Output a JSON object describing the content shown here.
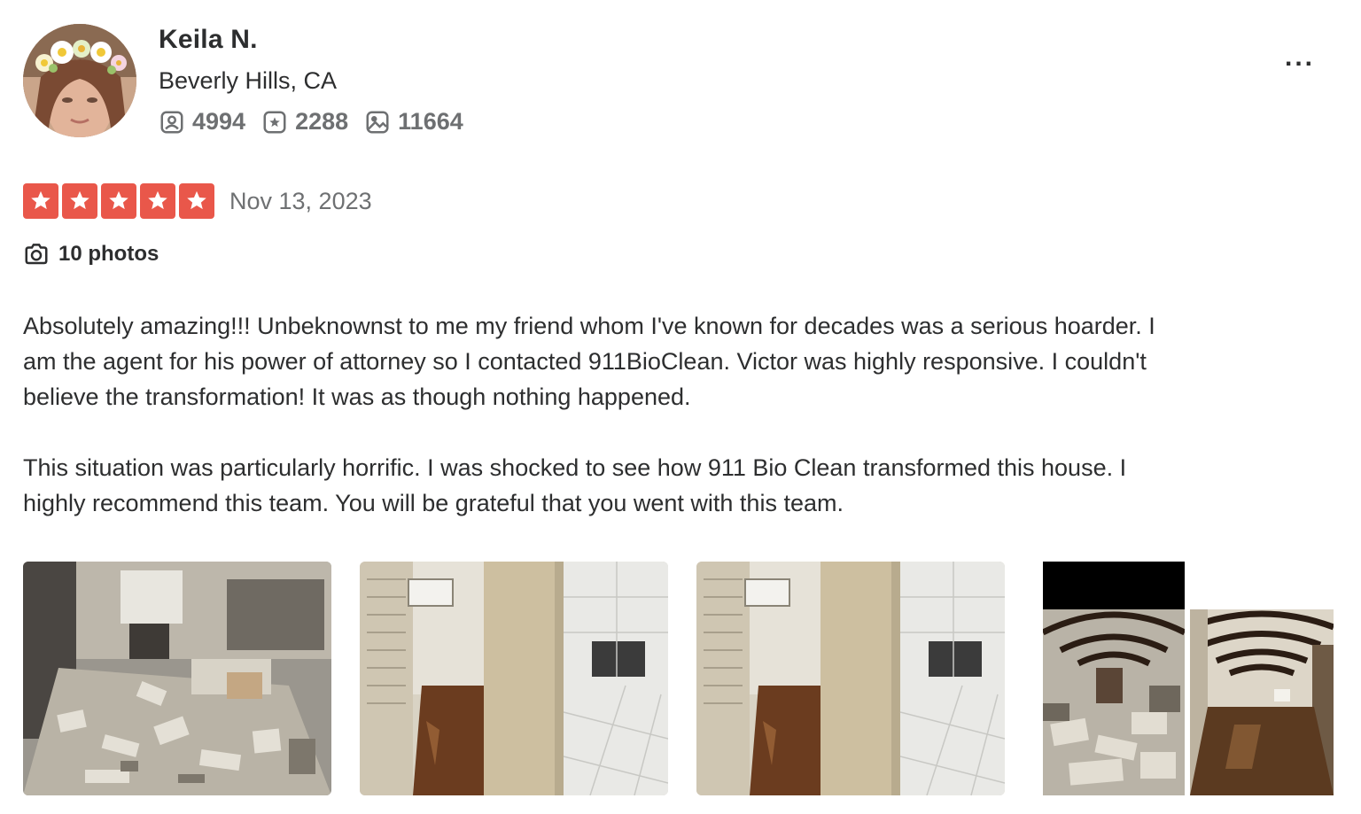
{
  "user": {
    "name": "Keila N.",
    "location": "Beverly Hills, CA",
    "stats": [
      {
        "icon": "friends-icon",
        "value": "4994"
      },
      {
        "icon": "reviews-icon",
        "value": "2288"
      },
      {
        "icon": "photos-icon",
        "value": "11664"
      }
    ]
  },
  "menu": {
    "more_label": "..."
  },
  "review": {
    "rating": 5,
    "rating_max": 5,
    "date": "Nov 13, 2023",
    "photos_label": "10 photos",
    "paragraphs": [
      "Absolutely amazing!!! Unbeknownst to me my friend whom I've known for decades was a serious hoarder. I am the agent for his power of attorney so I contacted 911BioClean. Victor was highly responsive. I couldn't believe the transformation! It was as though nothing happened.",
      "This situation was particularly horrific. I was shocked to see how 911 Bio Clean transformed this house. I highly recommend this team. You will be grateful that you went with this team."
    ]
  },
  "colors": {
    "star_red": "#e9574a",
    "text_dark": "#2d2e2f",
    "text_muted": "#6e7072"
  }
}
